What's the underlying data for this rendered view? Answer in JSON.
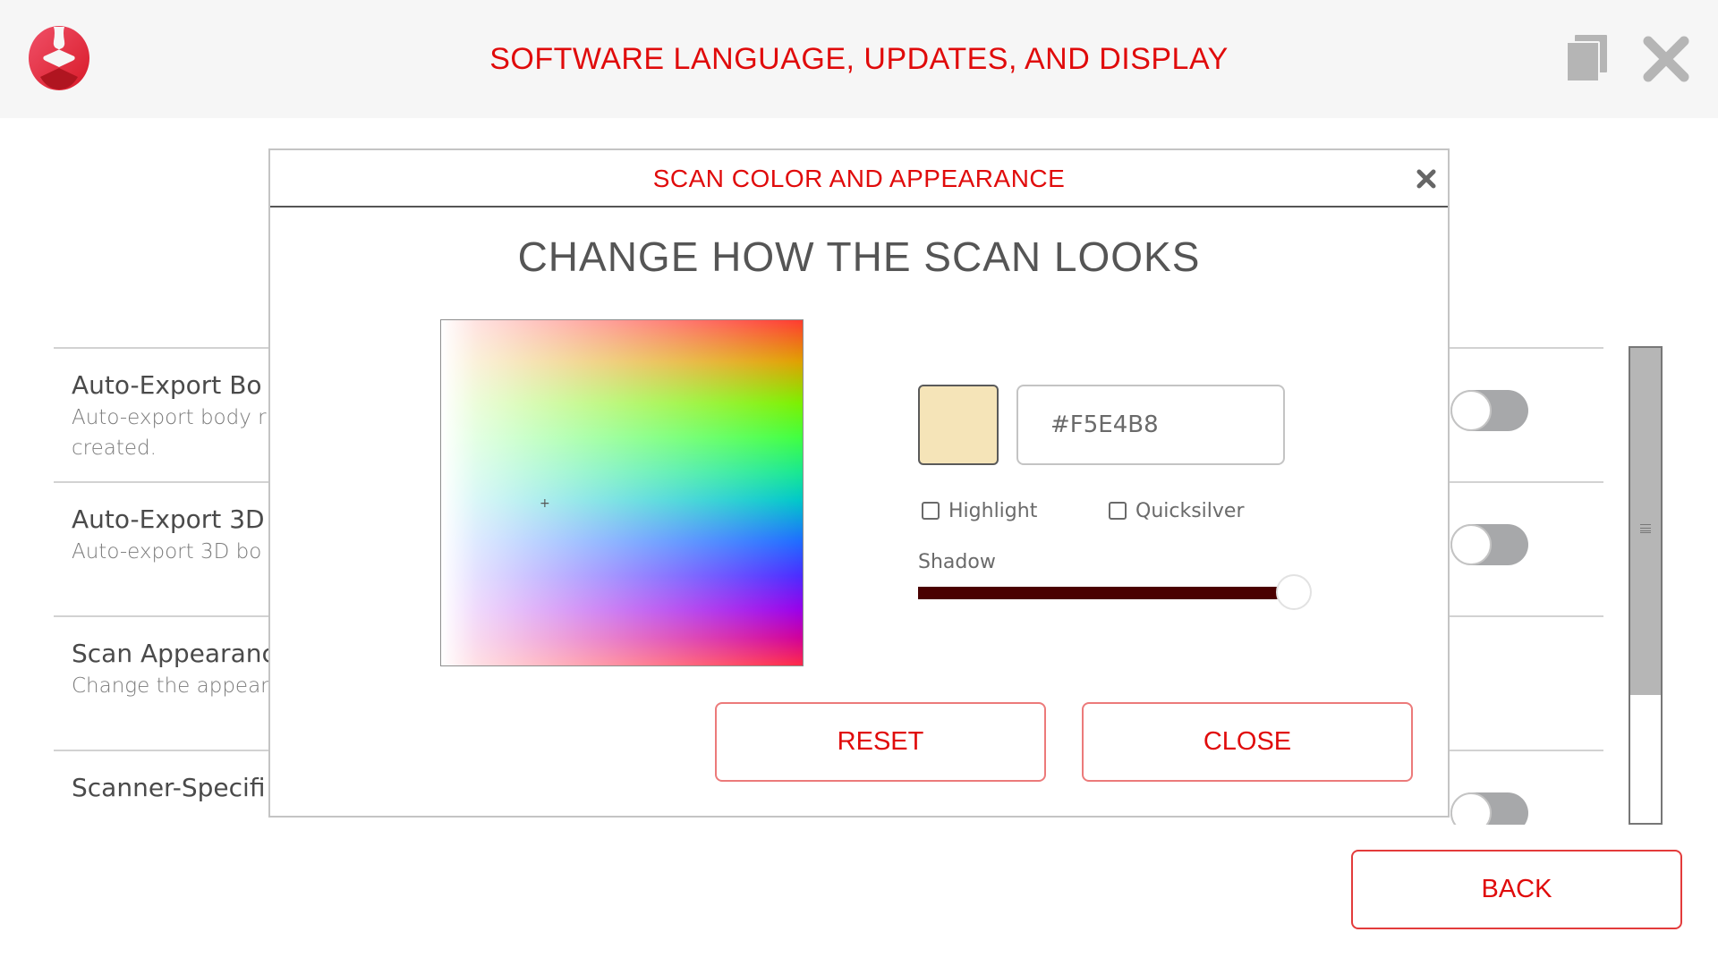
{
  "header": {
    "title": "SOFTWARE LANGUAGE, UPDATES, AND DISPLAY",
    "icons": [
      "logo",
      "copy-icon",
      "close-icon"
    ]
  },
  "settings": {
    "rows": [
      {
        "title": "Auto-Export Bo",
        "description": "Auto-export body r",
        "description_line2": "created.",
        "toggle_on": false
      },
      {
        "title": "Auto-Export 3D",
        "description": "Auto-export 3D bo",
        "toggle_on": false
      },
      {
        "title": "Scan Appearanc",
        "description": "Change the appear"
      },
      {
        "title": "Scanner-Specifi",
        "toggle_on": false
      }
    ],
    "scroll_position": 0.0
  },
  "back_button": {
    "label": "BACK"
  },
  "modal": {
    "title": "SCAN COLOR AND APPEARANCE",
    "heading": "CHANGE HOW THE SCAN LOOKS",
    "color": {
      "hex_value": "#F5E4B8",
      "swatch_color": "#F5E4B8"
    },
    "options": {
      "highlight_label": "Highlight",
      "highlight_checked": false,
      "quicksilver_label": "Quicksilver",
      "quicksilver_checked": false
    },
    "shadow": {
      "label": "Shadow",
      "value_percent": 100,
      "fill_color": "#4a0000"
    },
    "buttons": {
      "reset_label": "RESET",
      "close_label": "CLOSE"
    }
  },
  "colors": {
    "accent": "#e00b0b",
    "toggle_off": "#a7a8aa"
  }
}
